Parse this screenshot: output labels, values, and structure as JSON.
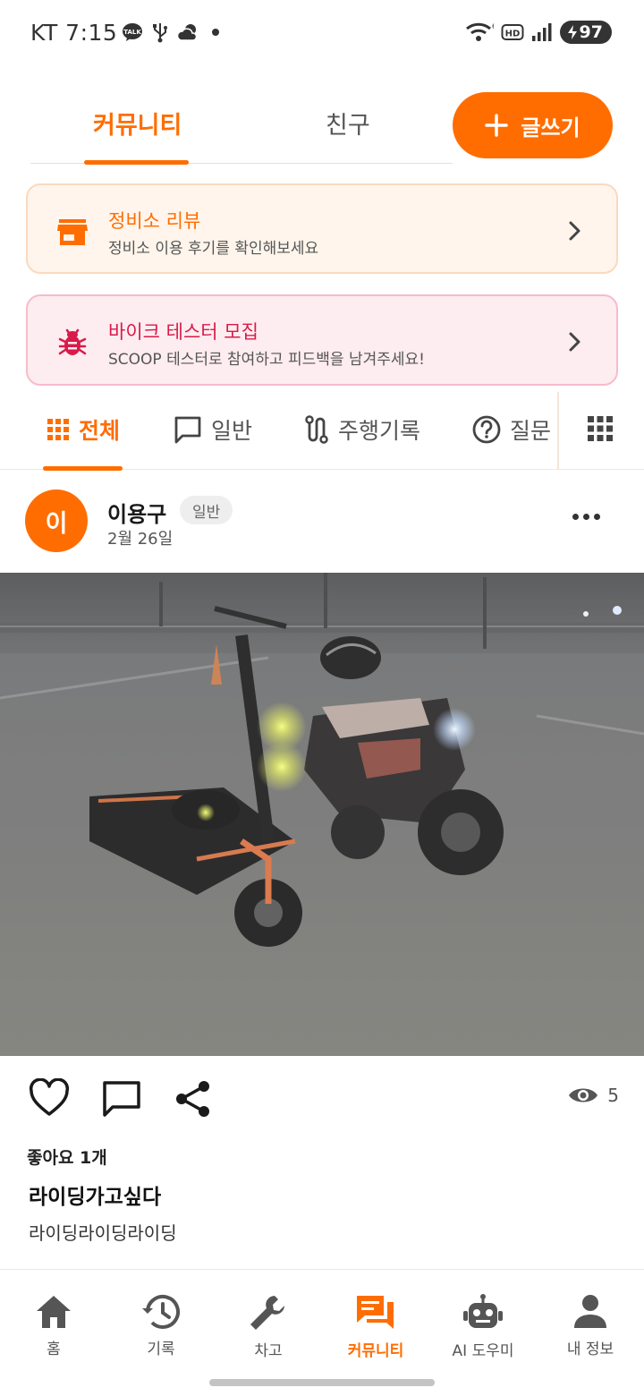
{
  "status_bar": {
    "carrier": "KT 7:15",
    "battery": "97",
    "icons_left": [
      "kakaotalk-icon",
      "usb-icon",
      "weather-icon",
      "dot-icon"
    ],
    "icons_right": [
      "wifi-icon",
      "hd-icon",
      "signal-icon",
      "battery-icon"
    ]
  },
  "top_tabs": [
    {
      "label": "커뮤니티",
      "active": true
    },
    {
      "label": "친구",
      "active": false
    }
  ],
  "write_button": {
    "label": "글쓰기",
    "icon": "plus-icon"
  },
  "banners": [
    {
      "title": "정비소 리뷰",
      "subtitle": "정비소 이용 후기를 확인해보세요",
      "icon": "store-icon",
      "color": "#ff6d00"
    },
    {
      "title": "바이크 테스터 모집",
      "subtitle": "SCOOP 테스터로 참여하고 피드백을 남겨주세요!",
      "icon": "bug-icon",
      "color": "#d81b4a"
    }
  ],
  "category_tabs": [
    {
      "label": "전체",
      "icon": "grid-icon",
      "active": true
    },
    {
      "label": "일반",
      "icon": "chat-icon",
      "active": false
    },
    {
      "label": "주행기록",
      "icon": "route-icon",
      "active": false
    },
    {
      "label": "질문",
      "icon": "question-icon",
      "active": false
    }
  ],
  "post": {
    "avatar_initial": "이",
    "author": "이용구",
    "badge": "일반",
    "date": "2월 26일",
    "views": "5",
    "likes": "좋아요 1개",
    "title": "라이딩가고싶다",
    "body": "라이딩라이딩라이딩"
  },
  "bottom_nav": [
    {
      "label": "홈",
      "icon": "home-icon",
      "active": false
    },
    {
      "label": "기록",
      "icon": "history-icon",
      "active": false
    },
    {
      "label": "차고",
      "icon": "wrench-icon",
      "active": false
    },
    {
      "label": "커뮤니티",
      "icon": "forum-icon",
      "active": true
    },
    {
      "label": "AI 도우미",
      "icon": "robot-icon",
      "active": false
    },
    {
      "label": "내 정보",
      "icon": "person-icon",
      "active": false
    }
  ],
  "colors": {
    "accent": "#ff6d00",
    "tester": "#d81b4a"
  }
}
